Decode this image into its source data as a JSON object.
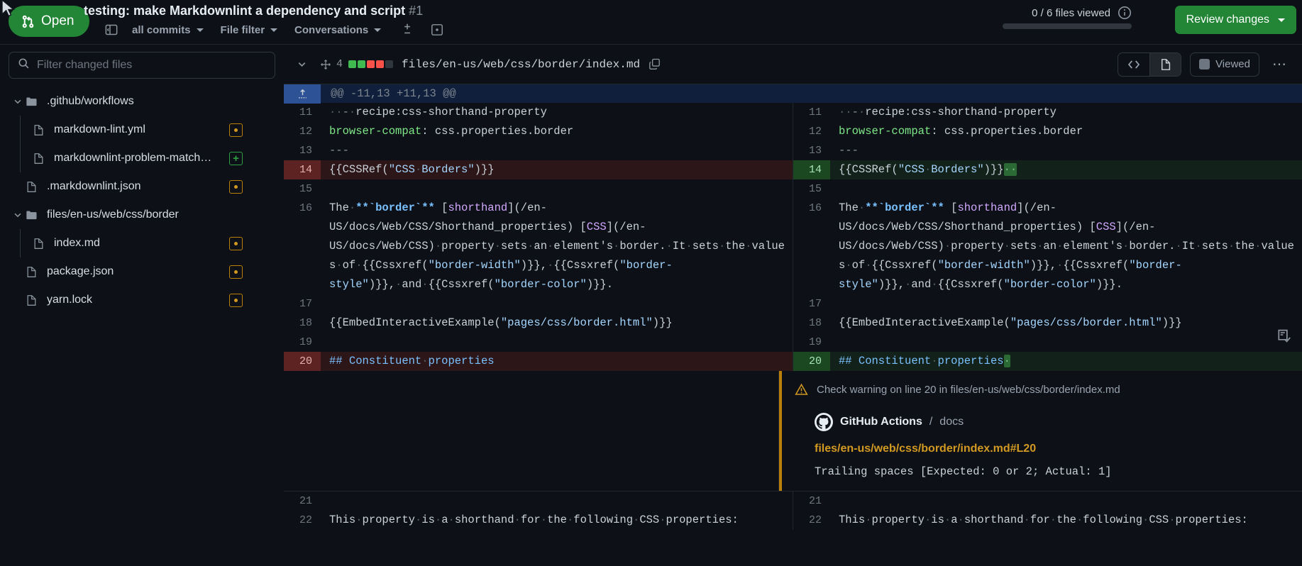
{
  "header": {
    "state_label": "Open",
    "state_icon": "pull-request-icon",
    "title": "testing: make Markdownlint a dependency and script",
    "number": "#1",
    "toolbar": {
      "sidebar_toggle_icon": "sidebar-expand-icon",
      "commits_filter": "all commits",
      "file_filter": "File filter",
      "conversations": "Conversations",
      "diff_settings_icon": "unified-split-icon",
      "whitespace_icon": "whitespace-toggle-icon"
    },
    "viewed": {
      "text": "0 / 6 files viewed",
      "info_icon": "info-icon",
      "progress_percent": 0
    },
    "review_button": "Review changes",
    "accent_green": "#238636"
  },
  "sidebar": {
    "filter": {
      "placeholder": "Filter changed files",
      "value": "",
      "icon": "search-icon"
    },
    "items": [
      {
        "label": ".github/workflows",
        "type": "folder",
        "depth": 0,
        "expanded": true,
        "status": "none"
      },
      {
        "label": "markdown-lint.yml",
        "type": "file",
        "depth": 1,
        "status": "modified"
      },
      {
        "label": "markdownlint-problem-match…",
        "type": "file",
        "depth": 1,
        "status": "added"
      },
      {
        "label": ".markdownlint.json",
        "type": "file",
        "depth": 0,
        "status": "modified"
      },
      {
        "label": "files/en-us/web/css/border",
        "type": "folder",
        "depth": 0,
        "expanded": true,
        "status": "none"
      },
      {
        "label": "index.md",
        "type": "file",
        "depth": 1,
        "status": "modified"
      },
      {
        "label": "package.json",
        "type": "file",
        "depth": 0,
        "status": "modified"
      },
      {
        "label": "yarn.lock",
        "type": "file",
        "depth": 0,
        "status": "modified"
      }
    ],
    "status_colors": {
      "modified": "#d29922",
      "added": "#2ea043"
    }
  },
  "file_header": {
    "collapse_icon": "chevron-down-icon",
    "move_icon": "move-handle-icon",
    "change_count": "4",
    "diffstat_blocks": [
      "add",
      "add",
      "del",
      "del",
      "neutral"
    ],
    "path": "files/en-us/web/css/border/index.md",
    "copy_icon": "copy-icon",
    "view_code_icon": "code-view-icon",
    "view_rendered_icon": "file-view-icon",
    "viewed_label": "Viewed",
    "kebab_icon": "kebab-menu-icon"
  },
  "diff": {
    "hunk_header": "@@ -11,13 +11,13 @@",
    "hunk_expand_icon": "expand-up-icon",
    "rows": [
      {
        "kind": "context",
        "left_no": "11",
        "right_no": "11",
        "html": "<span class=\"ws\">··</span><span class=\"tok-dash\">-</span><span class=\"ws\">·</span>recipe:css-shorthand-property"
      },
      {
        "kind": "context",
        "left_no": "12",
        "right_no": "12",
        "html": "<span class=\"tok-key\">browser-compat</span>: css.properties.border"
      },
      {
        "kind": "context",
        "left_no": "13",
        "right_no": "13",
        "html": "<span class=\"tok-dash\">---</span>"
      },
      {
        "kind": "change",
        "left_no": "14",
        "right_no": "14",
        "left_html": "{{CSSRef(<span class=\"tok-str\">\"CSS<span class=\"ws\">·</span>Borders\"</span>)}}",
        "right_html": "{{CSSRef(<span class=\"tok-str\">\"CSS<span class=\"ws\">·</span>Borders\"</span>)}}<span class=\"ws-hl\">··</span>"
      },
      {
        "kind": "context",
        "left_no": "15",
        "right_no": "15",
        "html": ""
      },
      {
        "kind": "context",
        "left_no": "16",
        "right_no": "16",
        "html": "The<span class=\"ws\">·</span><span class=\"tok-bold\">**`border`**</span> [<span class=\"tok-link\">shorthand</span>](/en-US/docs/Web/CSS/Shorthand_properties) [<span class=\"tok-link\">CSS</span>](/en-US/docs/Web/CSS)<span class=\"ws\">·</span>property<span class=\"ws\">·</span>sets<span class=\"ws\">·</span>an<span class=\"ws\">·</span>element's<span class=\"ws\">·</span>border.<span class=\"ws\">·</span>It<span class=\"ws\">·</span>sets<span class=\"ws\">·</span>the<span class=\"ws\">·</span>values<span class=\"ws\">·</span>of<span class=\"ws\">·</span>{{Cssxref(<span class=\"tok-str\">\"border-width\"</span>)}},<span class=\"ws\">·</span>{{Cssxref(<span class=\"tok-str\">\"border-style\"</span>)}},<span class=\"ws\">·</span>and<span class=\"ws\">·</span>{{Cssxref(<span class=\"tok-str\">\"border-color\"</span>)}}."
      },
      {
        "kind": "context",
        "left_no": "17",
        "right_no": "17",
        "html": ""
      },
      {
        "kind": "context",
        "left_no": "18",
        "right_no": "18",
        "html": "{{EmbedInteractiveExample(<span class=\"tok-str\">\"pages/css/border.html\"</span>)}}"
      },
      {
        "kind": "context",
        "left_no": "19",
        "right_no": "19",
        "html": ""
      },
      {
        "kind": "change",
        "left_no": "20",
        "right_no": "20",
        "left_html": "<span class=\"tok-md\">## Constituent<span class=\"ws\">·</span>properties</span>",
        "right_html": "<span class=\"tok-md\">## Constituent<span class=\"ws\">·</span>properties</span><span class=\"ws-hl\">·</span>"
      },
      {
        "kind": "context",
        "left_no": "21",
        "right_no": "21",
        "html": ""
      },
      {
        "kind": "context",
        "left_no": "22",
        "right_no": "22",
        "html": "This<span class=\"ws\">·</span>property<span class=\"ws\">·</span>is<span class=\"ws\">·</span>a<span class=\"ws\">·</span>shorthand<span class=\"ws\">·</span>for<span class=\"ws\">·</span>the<span class=\"ws\">·</span>following<span class=\"ws\">·</span>CSS<span class=\"ws\">·</span>properties:"
      }
    ]
  },
  "annotation": {
    "warning_icon": "alert-triangle-icon",
    "title": "Check warning on line 20 in files/en-us/web/css/border/index.md",
    "actor_icon": "github-mark-icon",
    "actor": "GitHub Actions",
    "actor_separator": "/",
    "check_name": "docs",
    "link": "files/en-us/web/css/border/index.md#L20",
    "message": "Trailing spaces [Expected: 0 or 2; Actual: 1]",
    "action_icon": "add-review-comment-icon",
    "accent_color": "#bb8009"
  }
}
